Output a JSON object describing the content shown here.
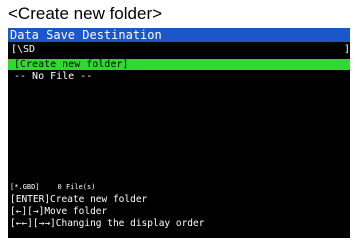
{
  "caption": "<Create new folder>",
  "window": {
    "title": "Data Save Destination",
    "path": "[\\SD",
    "path_suffix": "]"
  },
  "list": {
    "items": [
      {
        "label": "[Create new folder]",
        "selected": true
      },
      {
        "label": "-- No File --",
        "selected": false
      }
    ]
  },
  "status": {
    "filter": "[*.GBD]",
    "count": "0 File(s)"
  },
  "help": {
    "line1": "[ENTER]Create new folder",
    "line2": "[←][→]Move folder",
    "line3": "[←←][→→]Changing the display order"
  },
  "colors": {
    "title_bar": "#1c56c8",
    "selection": "#2fd92f",
    "screen_bg": "#000000"
  }
}
